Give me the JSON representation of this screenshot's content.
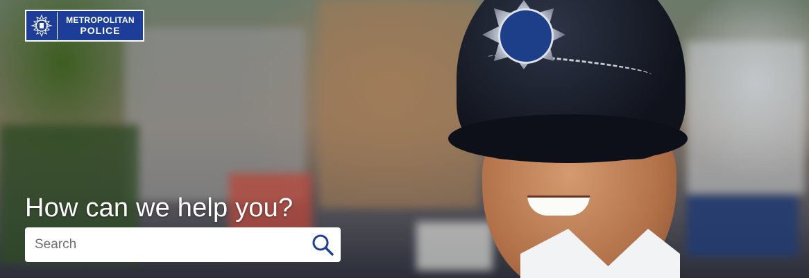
{
  "logo": {
    "line1": "METROPOLITAN",
    "line2": "POLICE"
  },
  "hero": {
    "heading": "How can we help you?"
  },
  "search": {
    "placeholder": "Search",
    "value": ""
  },
  "colors": {
    "brand_blue": "#1c3e98",
    "search_icon": "#1c3e98",
    "heading_text": "#ffffff"
  },
  "icons": {
    "crest": "crest-icon",
    "search": "search-icon"
  }
}
